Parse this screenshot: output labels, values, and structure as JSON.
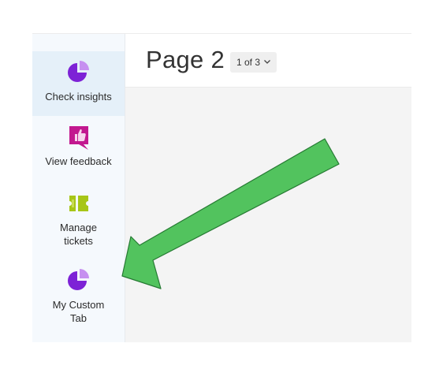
{
  "sidebar": {
    "items": [
      {
        "label": "Check insights",
        "icon": "pie-chart-icon",
        "active": true
      },
      {
        "label": "View feedback",
        "icon": "thumbs-up-bubble-icon",
        "active": false
      },
      {
        "label": "Manage tickets",
        "icon": "ticket-icon",
        "active": false
      },
      {
        "label": "My Custom Tab",
        "icon": "pie-chart-icon",
        "active": false
      }
    ]
  },
  "header": {
    "title": "Page 2",
    "page_selector": "1 of 3"
  },
  "colors": {
    "insights_purple": "#7d22d6",
    "insights_light": "#c690f0",
    "feedback_magenta": "#c2188f",
    "ticket_green": "#a7c617",
    "arrow_green": "#52c35e",
    "arrow_outline": "#267a33",
    "active_item_bg": "#e5f0f9"
  }
}
